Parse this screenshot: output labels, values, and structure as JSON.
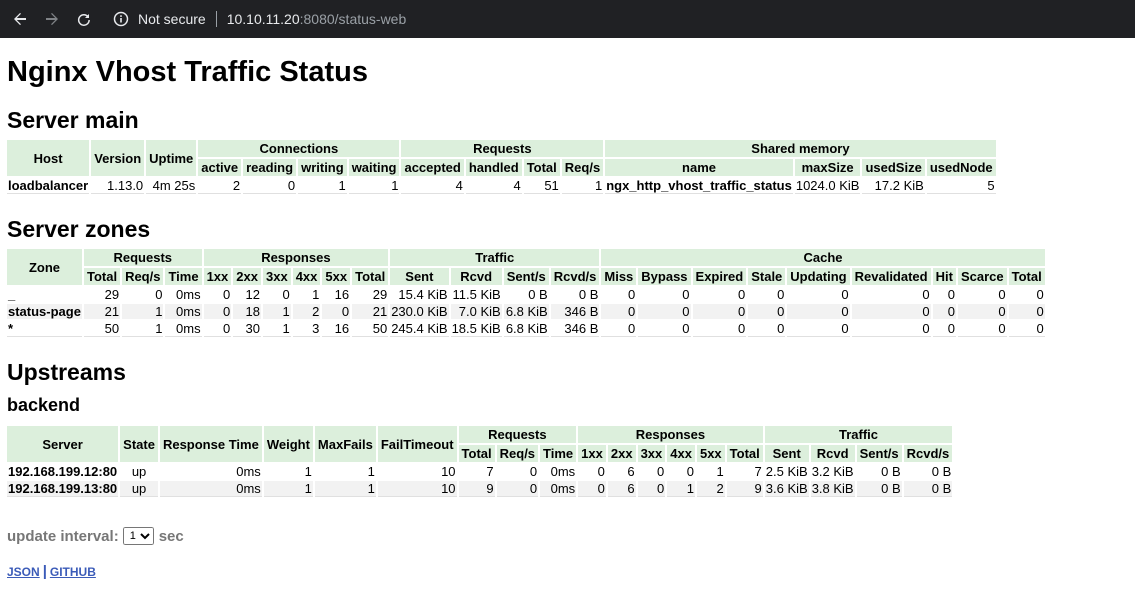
{
  "browser": {
    "not_secure": "Not secure",
    "url_host": "10.10.11.20",
    "url_rest": ":8080/status-web",
    "icons": [
      "back-icon",
      "forward-icon",
      "reload-icon",
      "info-icon"
    ]
  },
  "page": {
    "title": "Nginx Vhost Traffic Status",
    "server_main_heading": "Server main",
    "server_zones_heading": "Server zones",
    "upstreams_heading": "Upstreams",
    "upstream_group": "backend"
  },
  "server_main": {
    "groups": [
      "Host",
      "Version",
      "Uptime",
      "Connections",
      "Requests",
      "Shared memory"
    ],
    "sub": [
      "active",
      "reading",
      "writing",
      "waiting",
      "accepted",
      "handled",
      "Total",
      "Req/s",
      "name",
      "maxSize",
      "usedSize",
      "usedNode"
    ],
    "row": [
      "loadbalancer",
      "1.13.0",
      "4m 25s",
      "2",
      "0",
      "1",
      "1",
      "4",
      "4",
      "51",
      "1",
      "ngx_http_vhost_traffic_status",
      "1024.0 KiB",
      "17.2 KiB",
      "5"
    ]
  },
  "server_zones": {
    "groups": [
      "Zone",
      "Requests",
      "Responses",
      "Traffic",
      "Cache"
    ],
    "sub": [
      "Total",
      "Req/s",
      "Time",
      "1xx",
      "2xx",
      "3xx",
      "4xx",
      "5xx",
      "Total",
      "Sent",
      "Rcvd",
      "Sent/s",
      "Rcvd/s",
      "Miss",
      "Bypass",
      "Expired",
      "Stale",
      "Updating",
      "Revalidated",
      "Hit",
      "Scarce",
      "Total"
    ],
    "rows": [
      [
        "_",
        "29",
        "0",
        "0ms",
        "0",
        "12",
        "0",
        "1",
        "16",
        "29",
        "15.4 KiB",
        "11.5 KiB",
        "0 B",
        "0 B",
        "0",
        "0",
        "0",
        "0",
        "0",
        "0",
        "0",
        "0",
        "0"
      ],
      [
        "status-page",
        "21",
        "1",
        "0ms",
        "0",
        "18",
        "1",
        "2",
        "0",
        "21",
        "230.0 KiB",
        "7.0 KiB",
        "6.8 KiB",
        "346 B",
        "0",
        "0",
        "0",
        "0",
        "0",
        "0",
        "0",
        "0",
        "0"
      ],
      [
        "*",
        "50",
        "1",
        "0ms",
        "0",
        "30",
        "1",
        "3",
        "16",
        "50",
        "245.4 KiB",
        "18.5 KiB",
        "6.8 KiB",
        "346 B",
        "0",
        "0",
        "0",
        "0",
        "0",
        "0",
        "0",
        "0",
        "0"
      ]
    ]
  },
  "upstreams": {
    "groups": [
      "Server",
      "State",
      "Response Time",
      "Weight",
      "MaxFails",
      "FailTimeout",
      "Requests",
      "Responses",
      "Traffic"
    ],
    "sub": [
      "Total",
      "Req/s",
      "Time",
      "1xx",
      "2xx",
      "3xx",
      "4xx",
      "5xx",
      "Total",
      "Sent",
      "Rcvd",
      "Sent/s",
      "Rcvd/s"
    ],
    "rows": [
      [
        "192.168.199.12:80",
        "up",
        "0ms",
        "1",
        "1",
        "10",
        "7",
        "0",
        "0ms",
        "0",
        "6",
        "0",
        "0",
        "1",
        "7",
        "2.5 KiB",
        "3.2 KiB",
        "0 B",
        "0 B"
      ],
      [
        "192.168.199.13:80",
        "up",
        "0ms",
        "1",
        "1",
        "10",
        "9",
        "0",
        "0ms",
        "0",
        "6",
        "0",
        "1",
        "2",
        "9",
        "3.6 KiB",
        "3.8 KiB",
        "0 B",
        "0 B"
      ]
    ]
  },
  "footer": {
    "update_label": "update interval:",
    "interval_value": "1",
    "unit": "sec",
    "json_link": "JSON",
    "separator": "|",
    "github_link": "GITHUB"
  },
  "colors": {
    "header_bg": "#dcefdc",
    "link": "#3b5bb8",
    "chrome_bg": "#202124"
  }
}
